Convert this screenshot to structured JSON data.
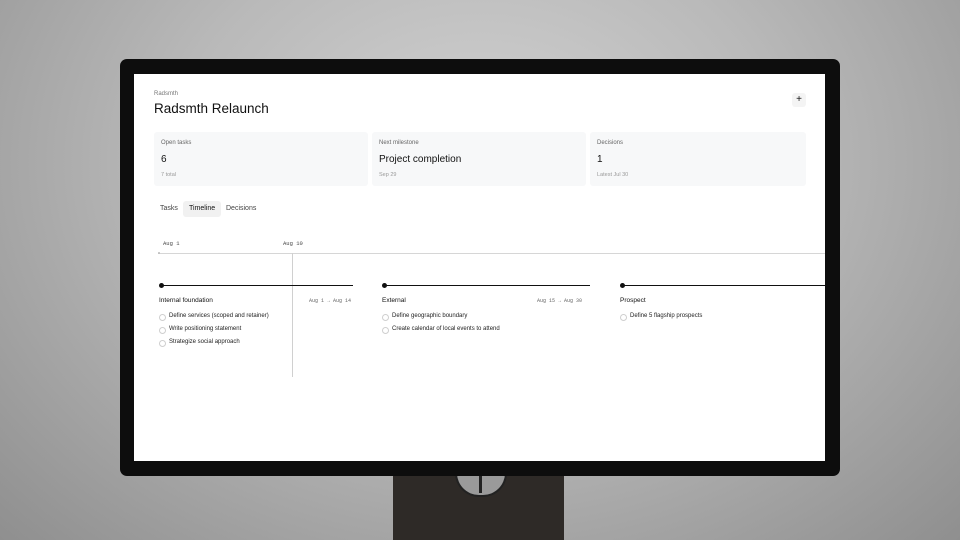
{
  "app": {
    "breadcrumb": "Radsmth",
    "title": "Radsmth Relaunch",
    "add_icon": "plus-icon",
    "add_glyph": "+"
  },
  "cards": [
    {
      "label": "Open tasks",
      "value": "6",
      "sub": "7 total"
    },
    {
      "label": "Next milestone",
      "value": "Project completion",
      "sub": "Sep 29"
    },
    {
      "label": "Decisions",
      "value": "1",
      "sub": "Latest Jul 30"
    }
  ],
  "tabs": [
    {
      "label": "Tasks",
      "active": false
    },
    {
      "label": "Timeline",
      "active": true
    },
    {
      "label": "Decisions",
      "active": false
    }
  ],
  "timeline": {
    "ticks": [
      "Aug 1",
      "Aug 10"
    ],
    "groups": [
      {
        "name": "Internal foundation",
        "dates": "Aug 1 → Aug 14",
        "tasks": [
          "Define services (scoped and retainer)",
          "Write positioning statement",
          "Strategize social approach"
        ]
      },
      {
        "name": "External",
        "dates": "Aug 15 → Aug 30",
        "tasks": [
          "Define geographic boundary",
          "Create calendar of local events to attend"
        ]
      },
      {
        "name": "Prospect",
        "dates": "",
        "tasks": [
          "Define 5 flagship prospects"
        ]
      }
    ]
  },
  "colors": {
    "accent": "#111111",
    "card_bg": "#f7f8f9",
    "screen_bg": "#ffffff",
    "bezel": "#0d0d0d"
  }
}
